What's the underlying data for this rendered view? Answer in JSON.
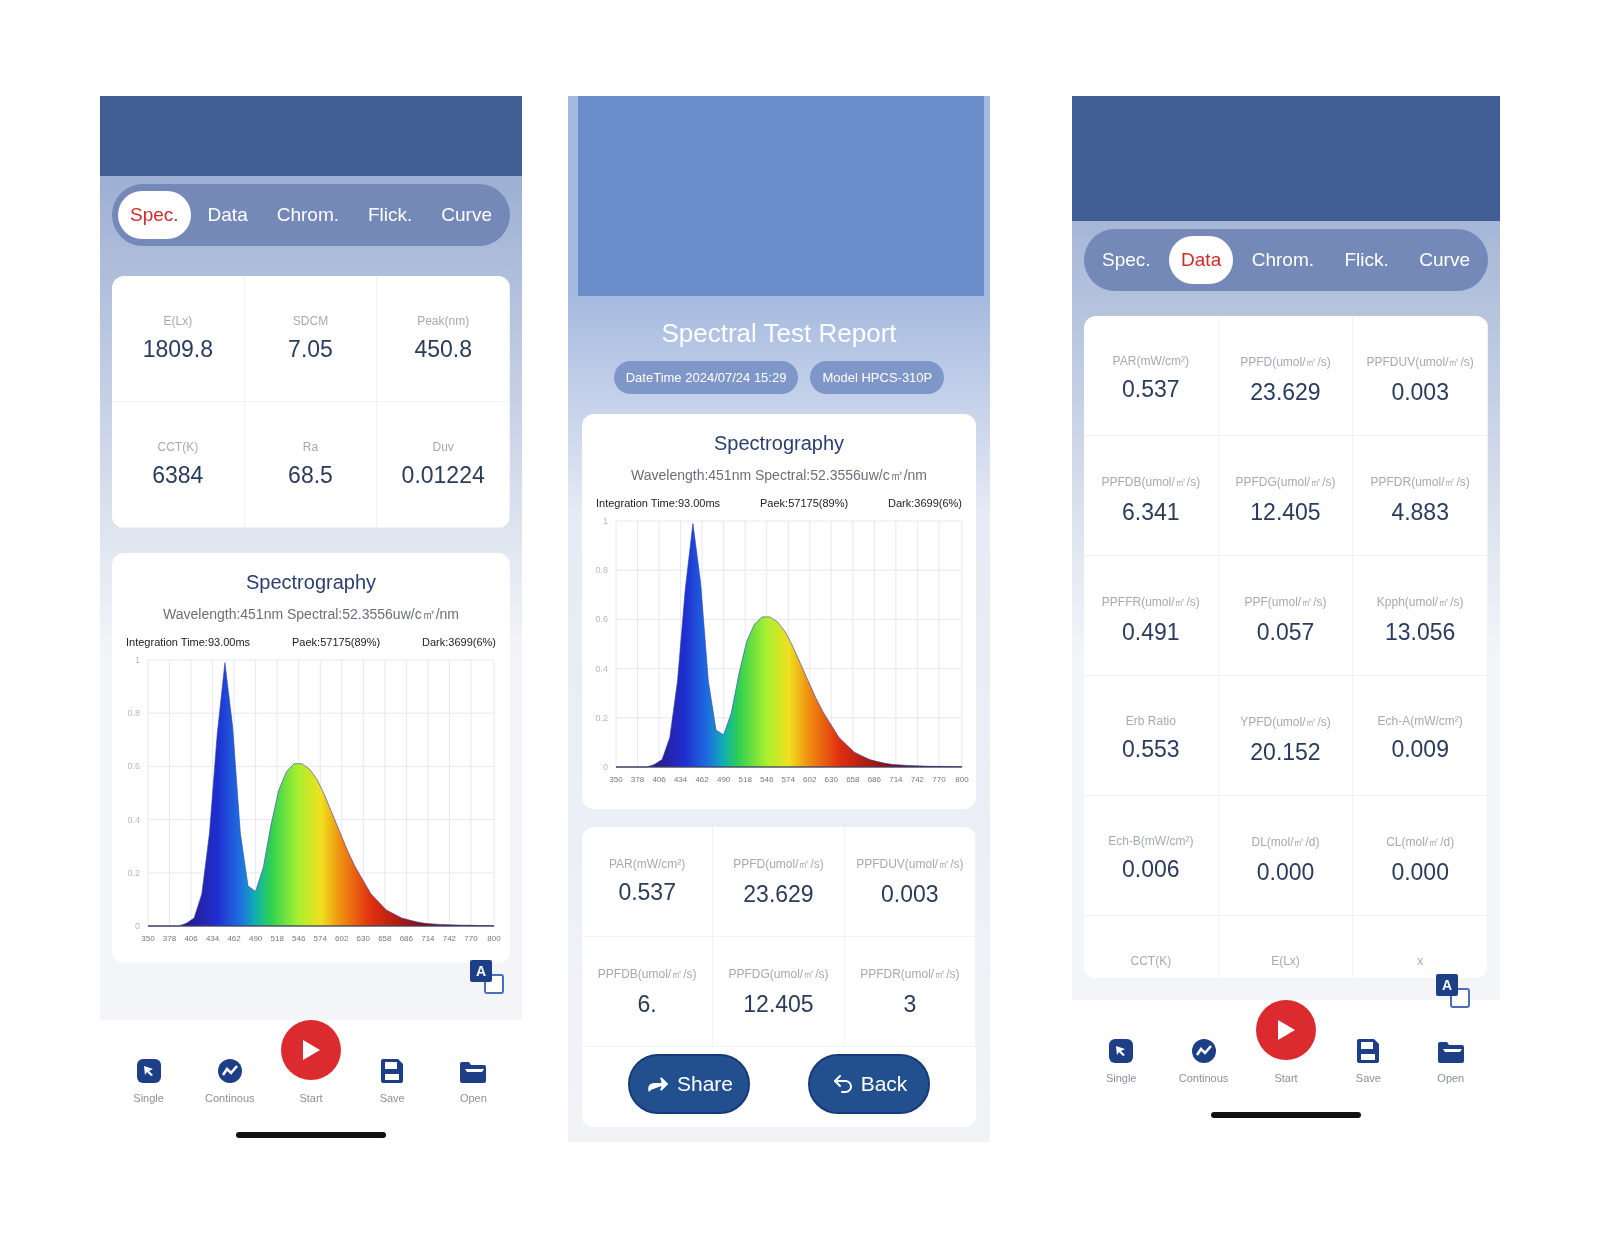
{
  "phones": [
    {
      "kind": "measure",
      "tabs": [
        {
          "label": "Spec.",
          "selected": true
        },
        {
          "label": "Data",
          "selected": false
        },
        {
          "label": "Chrom.",
          "selected": false
        },
        {
          "label": "Flick.",
          "selected": false
        },
        {
          "label": "Curve",
          "selected": false
        }
      ],
      "stats": [
        {
          "label": "E(Lx)",
          "value": "1809.8"
        },
        {
          "label": "SDCM",
          "value": "7.05"
        },
        {
          "label": "Peak(nm)",
          "value": "450.8"
        },
        {
          "label": "CCT(K)",
          "value": "6384"
        },
        {
          "label": "Ra",
          "value": "68.5"
        },
        {
          "label": "Duv",
          "value": "0.01224"
        }
      ],
      "spectrum": {
        "title": "Spectrography",
        "info": "Wavelength:451nm Spectral:52.3556uw/c㎡/nm",
        "integration": "Integration Time:93.00ms",
        "peak": "Paek:57175(89%)",
        "dark": "Dark:3699(6%)",
        "chart_data": {
          "type": "area",
          "x": [
            350,
            360,
            370,
            380,
            390,
            400,
            410,
            420,
            430,
            440,
            450,
            460,
            470,
            480,
            490,
            500,
            510,
            520,
            530,
            540,
            550,
            560,
            570,
            580,
            590,
            600,
            610,
            620,
            630,
            640,
            650,
            660,
            670,
            680,
            690,
            700,
            710,
            720,
            730,
            740,
            750,
            760,
            770,
            780,
            790,
            800
          ],
          "series": [
            {
              "color": "#2a3cb0",
              "values": [
                0,
                0,
                0,
                0,
                0,
                0.01,
                0.03,
                0.12,
                0.35,
                0.72,
                0.99,
                0.75,
                0.35,
                0.15,
                0.13,
                0.22,
                0.38,
                0.51,
                0.58,
                0.61,
                0.61,
                0.59,
                0.55,
                0.49,
                0.42,
                0.35,
                0.28,
                0.22,
                0.17,
                0.12,
                0.09,
                0.06,
                0.045,
                0.03,
                0.022,
                0.015,
                0.01,
                0.008,
                0.006,
                0.005,
                0.004,
                0.003,
                0.003,
                0.002,
                0.002,
                0.001
              ]
            }
          ],
          "xlim": [
            350,
            800
          ],
          "ylim": [
            0,
            1
          ],
          "grid": true,
          "xticks": [
            350,
            378,
            406,
            434,
            462,
            490,
            518,
            546,
            574,
            602,
            630,
            658,
            686,
            714,
            742,
            770,
            800
          ],
          "yticks": [
            0,
            0.2,
            0.4,
            0.6,
            0.8,
            1
          ]
        }
      },
      "translate": "A",
      "nav": [
        {
          "kind": "single",
          "label": "Single"
        },
        {
          "kind": "continuous",
          "label": "Continous"
        },
        {
          "kind": "start",
          "label": "Start"
        },
        {
          "kind": "save",
          "label": "Save"
        },
        {
          "kind": "open",
          "label": "Open"
        }
      ]
    },
    {
      "kind": "report",
      "title": "Spectral Test Report",
      "pills": [
        "DateTime 2024/07/24 15:29",
        "Model HPCS-310P"
      ],
      "spectrum": {
        "title": "Spectrography",
        "info": "Wavelength:451nm Spectral:52.3556uw/c㎡/nm",
        "integration": "Integration Time:93.00ms",
        "peak": "Paek:57175(89%)",
        "dark": "Dark:3699(6%)",
        "chart_data": {
          "type": "area",
          "x": [
            350,
            360,
            370,
            380,
            390,
            400,
            410,
            420,
            430,
            440,
            450,
            460,
            470,
            480,
            490,
            500,
            510,
            520,
            530,
            540,
            550,
            560,
            570,
            580,
            590,
            600,
            610,
            620,
            630,
            640,
            650,
            660,
            670,
            680,
            690,
            700,
            710,
            720,
            730,
            740,
            750,
            760,
            770,
            780,
            790,
            800
          ],
          "series": [
            {
              "color": "#2a3cb0",
              "values": [
                0,
                0,
                0,
                0,
                0,
                0.01,
                0.03,
                0.12,
                0.35,
                0.72,
                0.99,
                0.75,
                0.35,
                0.15,
                0.13,
                0.22,
                0.38,
                0.51,
                0.58,
                0.61,
                0.61,
                0.59,
                0.55,
                0.49,
                0.42,
                0.35,
                0.28,
                0.22,
                0.17,
                0.12,
                0.09,
                0.06,
                0.045,
                0.03,
                0.022,
                0.015,
                0.01,
                0.008,
                0.006,
                0.005,
                0.004,
                0.003,
                0.003,
                0.002,
                0.002,
                0.001
              ]
            }
          ],
          "xlim": [
            350,
            800
          ],
          "ylim": [
            0,
            1
          ],
          "grid": true,
          "xticks": [
            350,
            378,
            406,
            434,
            462,
            490,
            518,
            546,
            574,
            602,
            630,
            658,
            686,
            714,
            742,
            770,
            800
          ],
          "yticks": [
            0,
            0.2,
            0.4,
            0.6,
            0.8,
            1
          ]
        }
      },
      "stats": [
        {
          "label": "PAR(mW/cm²)",
          "value": "0.537"
        },
        {
          "label": "PPFD(umol/㎡/s)",
          "value": "23.629"
        },
        {
          "label": "PPFDUV(umol/㎡/s)",
          "value": "0.003"
        },
        {
          "label": "PPFDB(umol/㎡/s)",
          "value": "6."
        },
        {
          "label": "PPFDG(umol/㎡/s)",
          "value": "12.405"
        },
        {
          "label": "PPFDR(umol/㎡/s)",
          "value": "3"
        }
      ],
      "actions": [
        {
          "kind": "share",
          "label": "Share"
        },
        {
          "kind": "back",
          "label": "Back"
        }
      ]
    },
    {
      "kind": "measure",
      "tabs": [
        {
          "label": "Spec.",
          "selected": false
        },
        {
          "label": "Data",
          "selected": true
        },
        {
          "label": "Chrom.",
          "selected": false
        },
        {
          "label": "Flick.",
          "selected": false
        },
        {
          "label": "Curve",
          "selected": false
        }
      ],
      "stats": [
        {
          "label": "PAR(mW/cm²)",
          "value": "0.537"
        },
        {
          "label": "PPFD(umol/㎡/s)",
          "value": "23.629"
        },
        {
          "label": "PPFDUV(umol/㎡/s)",
          "value": "0.003"
        },
        {
          "label": "PPFDB(umol/㎡/s)",
          "value": "6.341"
        },
        {
          "label": "PPFDG(umol/㎡/s)",
          "value": "12.405"
        },
        {
          "label": "PPFDR(umol/㎡/s)",
          "value": "4.883"
        },
        {
          "label": "PPFFR(umol/㎡/s)",
          "value": "0.491"
        },
        {
          "label": "PPF(umol/㎡/s)",
          "value": "0.057"
        },
        {
          "label": "Kpph(umol/㎡/s)",
          "value": "13.056"
        },
        {
          "label": "Erb Ratio",
          "value": "0.553"
        },
        {
          "label": "YPFD(umol/㎡/s)",
          "value": "20.152"
        },
        {
          "label": "Ech-A(mW/cm²)",
          "value": "0.009"
        },
        {
          "label": "Ech-B(mW/cm²)",
          "value": "0.006"
        },
        {
          "label": "DL(mol/㎡/d)",
          "value": "0.000"
        },
        {
          "label": "CL(mol/㎡/d)",
          "value": "0.000"
        },
        {
          "label": "CCT(K)"
        },
        {
          "label": "E(Lx)"
        },
        {
          "label": "x"
        }
      ],
      "translate": "A",
      "nav": [
        {
          "kind": "single",
          "label": "Single"
        },
        {
          "kind": "continuous",
          "label": "Continous"
        },
        {
          "kind": "start",
          "label": "Start"
        },
        {
          "kind": "save",
          "label": "Save"
        },
        {
          "kind": "open",
          "label": "Open"
        }
      ]
    }
  ]
}
